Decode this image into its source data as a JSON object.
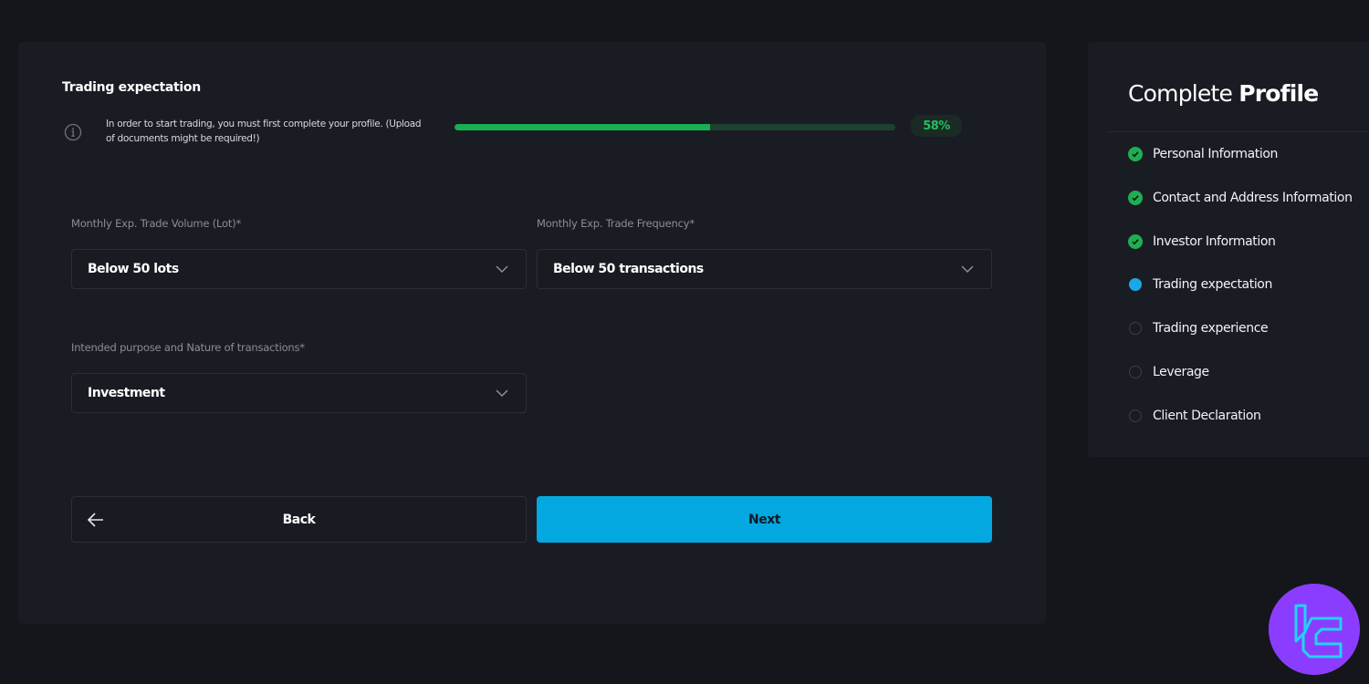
{
  "form": {
    "title": "Trading expectation",
    "info_icon": "info-icon",
    "info_text": "In order to start trading, you must first complete your profile. (Upload of documents might be required!)",
    "progress": {
      "percent": 58,
      "label": "58%"
    },
    "fields": [
      {
        "label": "Monthly Exp. Trade Volume (Lot)*",
        "value": "Below 50 lots",
        "icon": "chevron-down-icon"
      },
      {
        "label": "Monthly Exp. Trade Frequency*",
        "value": "Below 50 transactions",
        "icon": "chevron-down-icon"
      },
      {
        "label": "Intended purpose and Nature of transactions*",
        "value": "Investment",
        "icon": "chevron-down-icon"
      }
    ],
    "back_label": "Back",
    "back_icon": "arrow-left-icon",
    "next_label": "Next"
  },
  "sidebar": {
    "title_light": "Complete",
    "title_bold": "Profile",
    "steps": [
      {
        "label": "Personal Information",
        "status": "done"
      },
      {
        "label": "Contact and Address Information",
        "status": "done"
      },
      {
        "label": "Investor Information",
        "status": "done"
      },
      {
        "label": "Trading expectation",
        "status": "active"
      },
      {
        "label": "Trading experience",
        "status": "pending"
      },
      {
        "label": "Leverage",
        "status": "pending"
      },
      {
        "label": "Client Declaration",
        "status": "pending"
      }
    ]
  },
  "colors": {
    "accent": "#04a8e0",
    "success": "#1fae51",
    "progress_fill": "#17b053",
    "logo_bg": "#8b3dff",
    "logo_fg": "#22d3f5"
  },
  "watermark": {
    "icon": "tradingfinder-logo-icon"
  }
}
